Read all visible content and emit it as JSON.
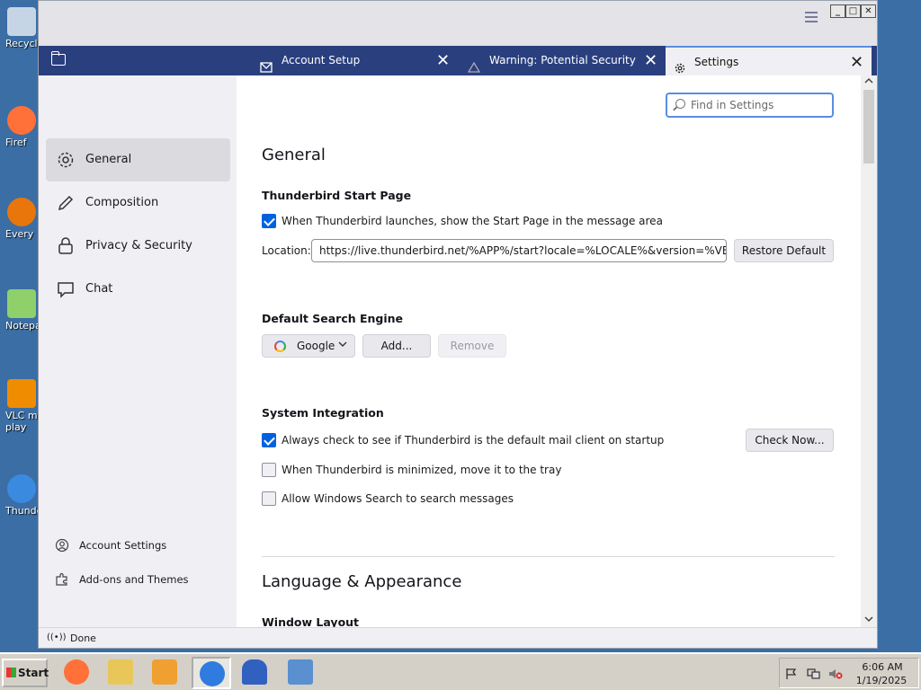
{
  "desktop": {
    "icons": [
      {
        "label": "Recycl",
        "color": "#c6d5e6"
      },
      {
        "label": "Firef",
        "color": "#ff7139"
      },
      {
        "label": "Every",
        "color": "#e8760a"
      },
      {
        "label": "Notepa",
        "color": "#8fd06a"
      },
      {
        "label": "VLC m\nplay",
        "color": "#f08c00"
      },
      {
        "label": "Thunde",
        "color": "#3a8ae0"
      }
    ]
  },
  "window": {
    "controls": {
      "minimize": "_",
      "maximize": "□",
      "close": "✕"
    },
    "tabs": [
      {
        "label": "Account Setup",
        "icon": "envelope-icon",
        "active": false
      },
      {
        "label": "Warning: Potential Security Risk Ah",
        "icon": "warning-icon",
        "active": false
      },
      {
        "label": "Settings",
        "icon": "gear-icon",
        "active": true
      }
    ],
    "close_glyph": "✕"
  },
  "sidebar": {
    "items": [
      {
        "label": "General",
        "icon": "gear-icon",
        "selected": true
      },
      {
        "label": "Composition",
        "icon": "pencil-icon",
        "selected": false
      },
      {
        "label": "Privacy & Security",
        "icon": "lock-icon",
        "selected": false
      },
      {
        "label": "Chat",
        "icon": "chat-icon",
        "selected": false
      }
    ],
    "footer": [
      {
        "label": "Account Settings",
        "icon": "account-icon"
      },
      {
        "label": "Add-ons and Themes",
        "icon": "puzzle-icon"
      }
    ]
  },
  "search": {
    "placeholder": "Find in Settings"
  },
  "general": {
    "title": "General",
    "start_page": {
      "heading": "Thunderbird Start Page",
      "launch_checkbox": "When Thunderbird launches, show the Start Page in the message area",
      "launch_checked": true,
      "location_label": "Location:",
      "location_value": "https://live.thunderbird.net/%APP%/start?locale=%LOCALE%&version=%VERSI",
      "restore_button": "Restore Default"
    },
    "search_engine": {
      "heading": "Default Search Engine",
      "engine": "Google",
      "add_button": "Add...",
      "remove_button": "Remove"
    },
    "system_integration": {
      "heading": "System Integration",
      "default_check": "Always check to see if Thunderbird is the default mail client on startup",
      "default_checked": true,
      "check_now_button": "Check Now...",
      "tray_check": "When Thunderbird is minimized, move it to the tray",
      "tray_checked": false,
      "windows_search_check": "Allow Windows Search to search messages",
      "windows_search_checked": false
    }
  },
  "language": {
    "title": "Language & Appearance",
    "window_layout_heading": "Window Layout"
  },
  "statusbar": {
    "text": "Done",
    "icon": "broadcast-icon",
    "icon_glyph": "((•))"
  },
  "taskbar": {
    "start_label": "Start",
    "apps": [
      {
        "name": "firefox",
        "color": "#ff7139",
        "active": false
      },
      {
        "name": "explorer",
        "color": "#e8c65a",
        "active": false
      },
      {
        "name": "media-player",
        "color": "#f0a030",
        "active": false
      },
      {
        "name": "thunderbird",
        "color": "#2f7be0",
        "active": true
      },
      {
        "name": "unknown-app",
        "color": "#3060c0",
        "active": false
      },
      {
        "name": "control-panel",
        "color": "#5a8fd0",
        "active": false
      }
    ],
    "time": "6:06 AM",
    "date": "1/19/2025"
  }
}
